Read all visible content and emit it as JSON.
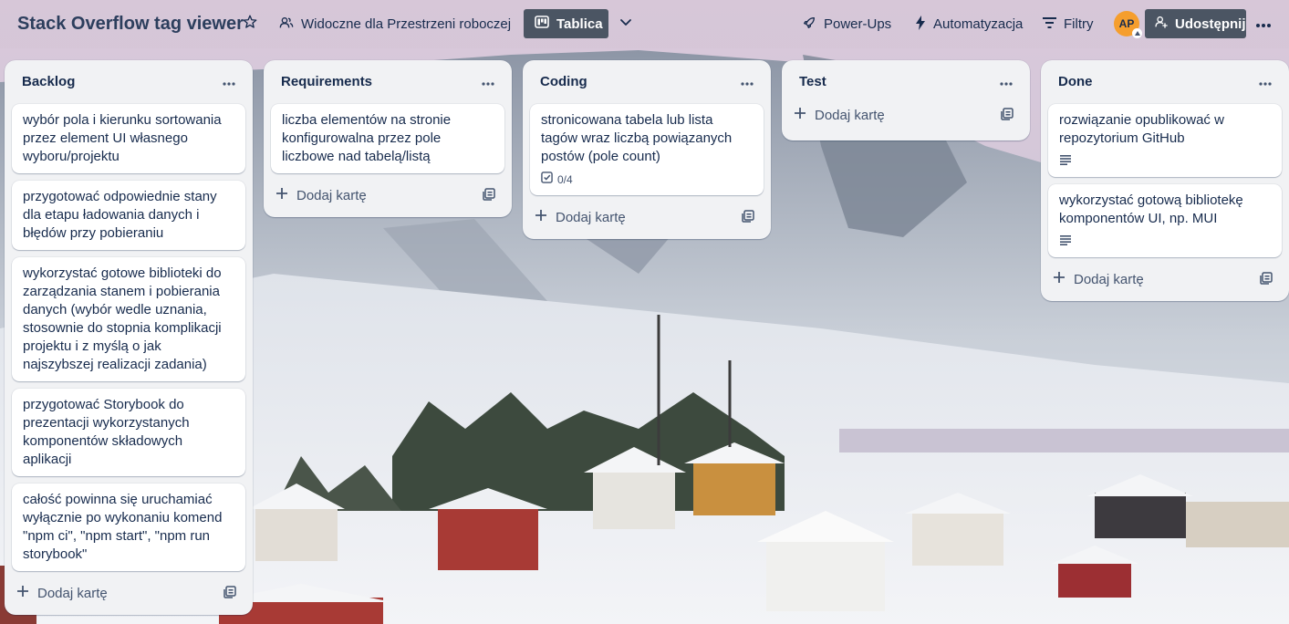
{
  "board": {
    "title": "Stack Overflow tag viewer",
    "visibility_label": "Widoczne dla Przestrzeni roboczej",
    "view_label": "Tablica",
    "powerups_label": "Power-Ups",
    "automation_label": "Automatyzacja",
    "filters_label": "Filtry",
    "avatar_initials": "AP",
    "share_label": "Udostępnij"
  },
  "colors": {
    "header_bg": "#d6c4d6",
    "list_bg": "#f1f2f4",
    "card_bg": "#ffffff",
    "text_primary": "#172b4d",
    "button_dark": "#4b5563",
    "avatar_bg": "#f59e2d"
  },
  "icons": {
    "star": "star-icon",
    "visibility": "people-icon",
    "view": "board-icon",
    "dropdown": "chevron-down-icon",
    "powerups": "rocket-icon",
    "automation": "lightning-icon",
    "filters": "filter-icon",
    "share": "add-person-icon",
    "more": "more-icon",
    "list_menu": "more-icon",
    "add_card": "plus-icon",
    "template": "template-icon",
    "description": "description-icon",
    "checklist": "checklist-icon"
  },
  "add_card_label": "Dodaj kartę",
  "lists": [
    {
      "title": "Backlog",
      "cards": [
        {
          "text": "wybór pola i kierunku sortowania przez element UI własnego wyboru/projektu"
        },
        {
          "text": "przygotować odpowiednie stany dla etapu ładowania danych i błędów przy pobieraniu"
        },
        {
          "text": "wykorzystać gotowe biblioteki do zarządzania stanem i pobierania danych (wybór wedle uznania, stosownie do stopnia komplikacji projektu i z myślą o jak najszybszej realizacji zadania)"
        },
        {
          "text": "przygotować Storybook do prezentacji wykorzystanych komponentów składowych aplikacji"
        },
        {
          "text": "całość powinna się uruchamiać wyłącznie po wykonaniu komend \"npm ci\", \"npm start\", \"npm run storybook\""
        }
      ]
    },
    {
      "title": "Requirements",
      "cards": [
        {
          "text": "liczba elementów na stronie konfigurowalna przez pole liczbowe nad tabelą/listą"
        }
      ]
    },
    {
      "title": "Coding",
      "cards": [
        {
          "text": "stronicowana tabela lub lista tagów wraz liczbą powiązanych postów (pole count)",
          "checklist": "0/4"
        }
      ]
    },
    {
      "title": "Test",
      "cards": []
    },
    {
      "title": "Done",
      "cards": [
        {
          "text": "rozwiązanie opublikować w repozytorium GitHub",
          "has_description": true
        },
        {
          "text": "wykorzystać gotową bibliotekę komponentów UI, np. MUI",
          "has_description": true
        }
      ]
    }
  ]
}
